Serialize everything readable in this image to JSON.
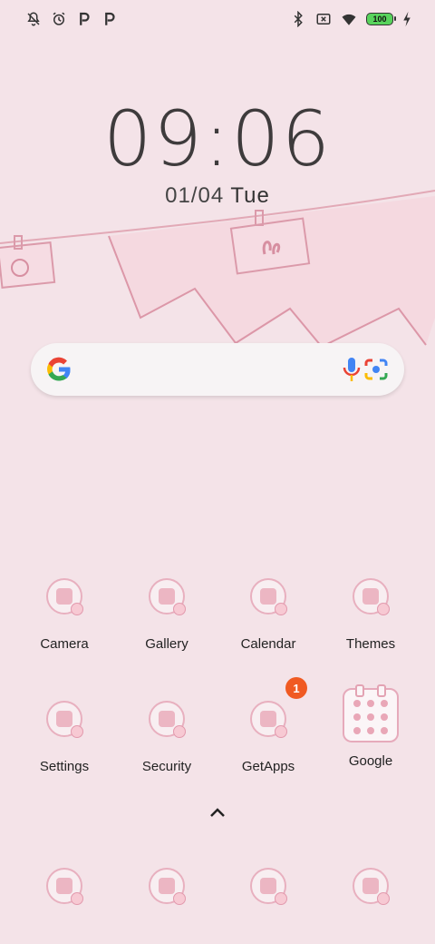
{
  "status_bar": {
    "left_icons": [
      "notification-off-icon",
      "alarm-icon",
      "parking-icon",
      "parking-icon"
    ],
    "right_icons": [
      "bluetooth-icon",
      "sim-off-icon",
      "wifi-icon"
    ],
    "battery": "100",
    "charging_icon": "bolt-icon"
  },
  "clock": {
    "time": "09:06",
    "date": "01/04",
    "day": "Tue"
  },
  "search": {
    "logo": "google-g-icon",
    "mic": "mic-icon",
    "lens": "lens-icon"
  },
  "apps": [
    {
      "label": "Camera"
    },
    {
      "label": "Gallery"
    },
    {
      "label": "Calendar"
    },
    {
      "label": "Themes"
    },
    {
      "label": "Settings"
    },
    {
      "label": "Security"
    },
    {
      "label": "GetApps",
      "badge": "1"
    },
    {
      "label": "Google"
    }
  ],
  "dock": [
    {
      "icon": "phone-icon"
    },
    {
      "icon": "contacts-icon"
    },
    {
      "icon": "browser-icon"
    },
    {
      "icon": "messages-icon"
    }
  ],
  "colors": {
    "background": "#f4e3e8",
    "accent": "#e8b0bf",
    "badge": "#f05a22"
  }
}
